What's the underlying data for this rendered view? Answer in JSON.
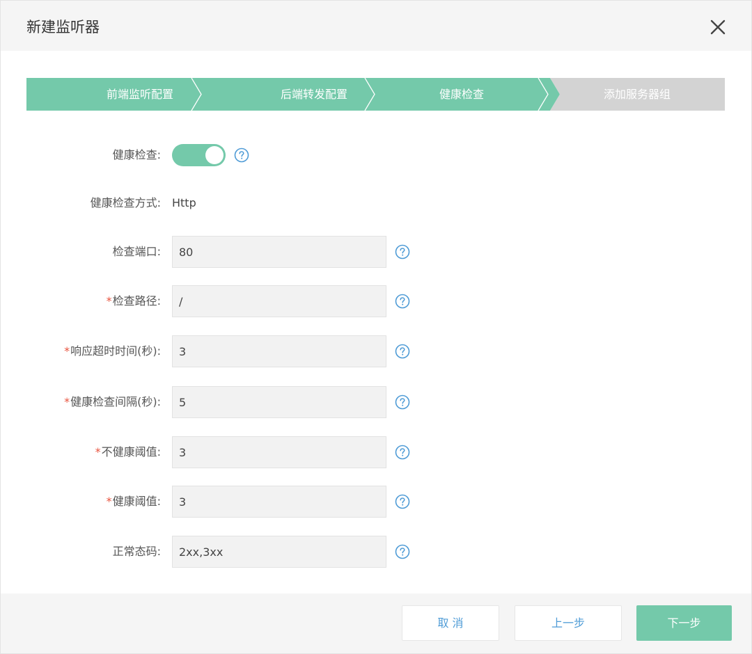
{
  "dialog": {
    "title": "新建监听器",
    "close_icon": "close-icon"
  },
  "steps": [
    {
      "label": "前端监听配置",
      "state": "done"
    },
    {
      "label": "后端转发配置",
      "state": "done"
    },
    {
      "label": "健康检查",
      "state": "active"
    },
    {
      "label": "添加服务器组",
      "state": "pending"
    }
  ],
  "colors": {
    "accent": "#74c9aa",
    "pending": "#d3d3d3",
    "required": "#e8543f",
    "link": "#4e9bd6"
  },
  "form": {
    "health_check": {
      "label": "健康检查:",
      "enabled": true
    },
    "method": {
      "label": "健康检查方式:",
      "value": "Http"
    },
    "port": {
      "label": "检查端口:",
      "value": "80"
    },
    "path": {
      "label": "检查路径:",
      "value": "/",
      "required": true
    },
    "timeout": {
      "label": "响应超时时间(秒):",
      "value": "3",
      "required": true
    },
    "interval": {
      "label": "健康检查间隔(秒):",
      "value": "5",
      "required": true
    },
    "unhealthy_threshold": {
      "label": "不健康阈值:",
      "value": "3",
      "required": true
    },
    "healthy_threshold": {
      "label": "健康阈值:",
      "value": "3",
      "required": true
    },
    "status_codes": {
      "label": "正常态码:",
      "value": "2xx,3xx"
    }
  },
  "footer": {
    "cancel": "取 消",
    "prev": "上一步",
    "next": "下一步"
  }
}
